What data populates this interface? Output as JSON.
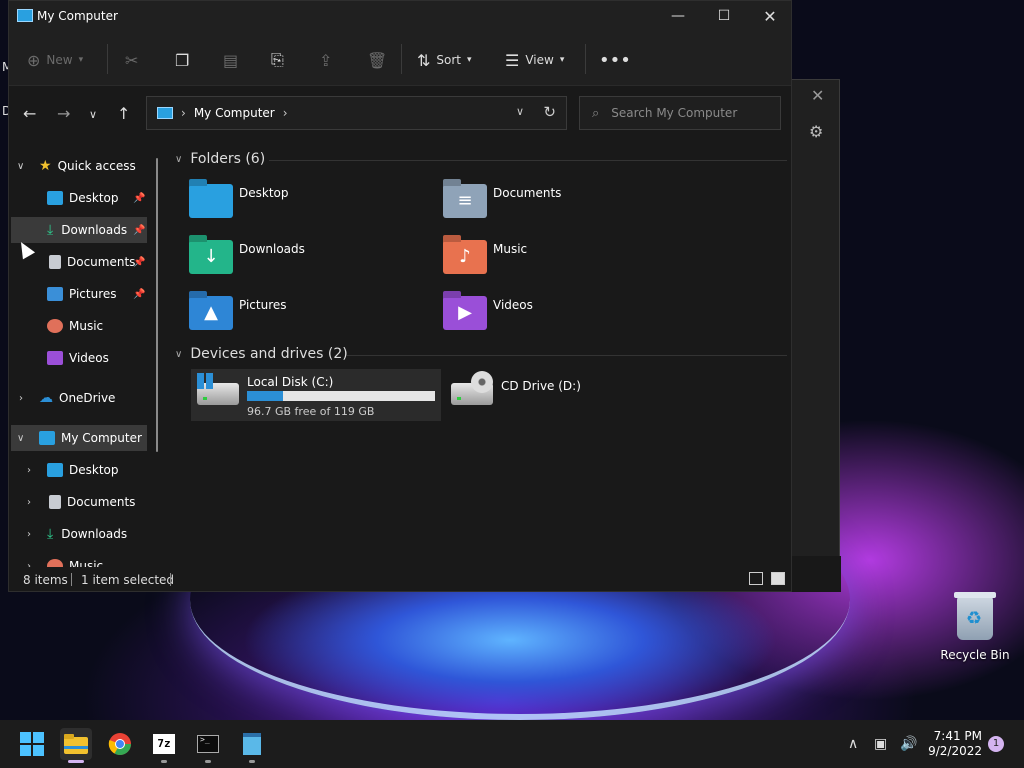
{
  "window": {
    "title": "My Computer"
  },
  "toolbar": {
    "new": "New",
    "sort": "Sort",
    "view": "View"
  },
  "address": {
    "location": "My Computer"
  },
  "search": {
    "placeholder": "Search My Computer"
  },
  "nav": {
    "quick_access": "Quick access",
    "qa_items": [
      "Desktop",
      "Downloads",
      "Documents",
      "Pictures",
      "Music",
      "Videos"
    ],
    "onedrive": "OneDrive",
    "my_computer": "My Computer",
    "pc_items": [
      "Desktop",
      "Documents",
      "Downloads",
      "Music"
    ]
  },
  "folders": {
    "header": "Folders (6)",
    "items": [
      "Desktop",
      "Documents",
      "Downloads",
      "Music",
      "Pictures",
      "Videos"
    ]
  },
  "drives": {
    "header": "Devices and drives (2)",
    "local": {
      "name": "Local Disk (C:)",
      "free": "96.7 GB free of 119 GB",
      "used_fraction": 0.19
    },
    "cd": {
      "name": "CD Drive (D:)"
    }
  },
  "status": {
    "items": "8 items",
    "selected": "1 item selected"
  },
  "desktop": {
    "recycle_bin": "Recycle Bin"
  },
  "taskbar": {
    "time": "7:41 PM",
    "date": "9/2/2022",
    "notifications": "1"
  },
  "colors": {
    "accent": "#2b8fd6",
    "window_bg": "#191919",
    "selection": "#3a3a3a"
  }
}
